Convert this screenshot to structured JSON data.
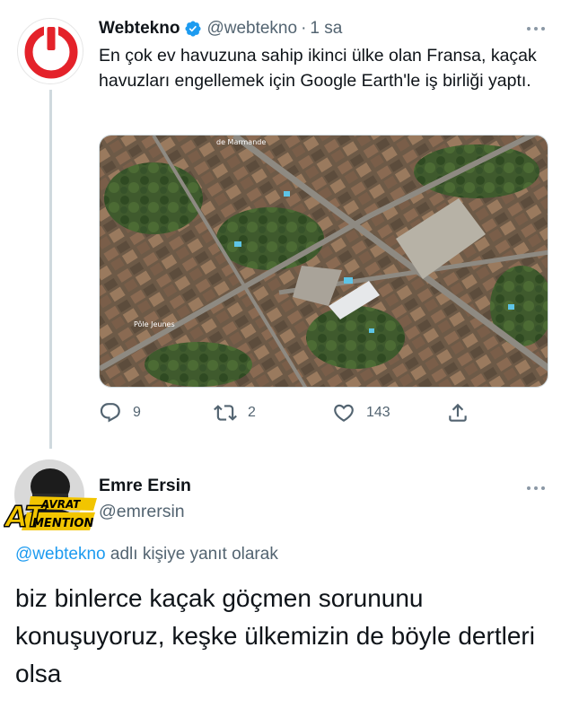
{
  "tweet": {
    "author_name": "Webtekno",
    "author_handle": "@webtekno",
    "separator": "·",
    "time": "1 sa",
    "text": "En çok ev havuzuna sahip ikinci ülke olan Fransa, kaçak havuzları engellemek için Google Earth'le iş birliği yaptı.",
    "map_labels": [
      "de Marmande",
      "Pôle Jeunes"
    ],
    "replies": "9",
    "retweets": "2",
    "likes": "143",
    "more_icon": "ellipsis-icon",
    "verified_icon": "verified-badge-icon",
    "brand_color": "#e4222a"
  },
  "reply": {
    "author_name": "Emre Ersin",
    "author_handle": "@emrersin",
    "replying_to": "@webtekno",
    "replying_suffix": " adlı kişiye yanıt olarak",
    "text": "biz binlerce kaçak göçmen sorununu konuşuyoruz, keşke ülkemizin de böyle dertleri olsa",
    "watermark_big": "AT",
    "watermark_top": "AVRAT",
    "watermark_bottom": "MENTION"
  },
  "colors": {
    "accent": "#1d9bf0",
    "secondary_text": "#536471",
    "primary_text": "#0f1419"
  }
}
